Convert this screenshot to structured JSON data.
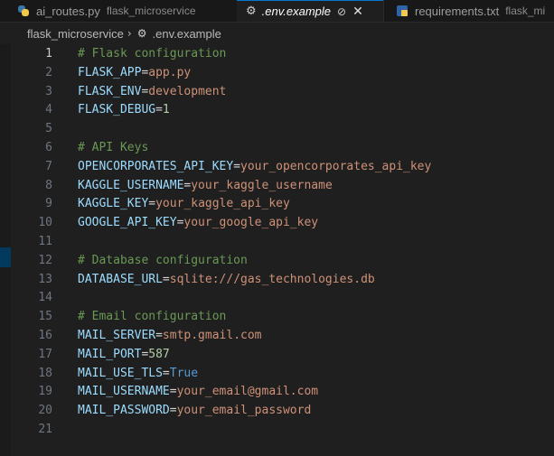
{
  "tabs": [
    {
      "label": "ai_routes.py",
      "description": "flask_microservice",
      "icon": "python-icon"
    },
    {
      "label": ".env.example",
      "icon": "settings-icon",
      "active": true,
      "pinned": true
    },
    {
      "label": "requirements.txt",
      "description": "flask_mi",
      "icon": "text-file-icon"
    }
  ],
  "breadcrumb": {
    "folder": "flask_microservice",
    "file": ".env.example"
  },
  "editor": {
    "lines": [
      {
        "num": "1",
        "comment": "# Flask configuration"
      },
      {
        "num": "2",
        "key": "FLASK_APP",
        "value": "app.py"
      },
      {
        "num": "3",
        "key": "FLASK_ENV",
        "value": "development"
      },
      {
        "num": "4",
        "key": "FLASK_DEBUG",
        "value": "1"
      },
      {
        "num": "5"
      },
      {
        "num": "6",
        "comment": "# API Keys"
      },
      {
        "num": "7",
        "key": "OPENCORPORATES_API_KEY",
        "value": "your_opencorporates_api_key"
      },
      {
        "num": "8",
        "key": "KAGGLE_USERNAME",
        "value": "your_kaggle_username"
      },
      {
        "num": "9",
        "key": "KAGGLE_KEY",
        "value": "your_kaggle_api_key"
      },
      {
        "num": "10",
        "key": "GOOGLE_API_KEY",
        "value": "your_google_api_key"
      },
      {
        "num": "11"
      },
      {
        "num": "12",
        "comment": "# Database configuration"
      },
      {
        "num": "13",
        "key": "DATABASE_URL",
        "value": "sqlite:///gas_technologies.db"
      },
      {
        "num": "14"
      },
      {
        "num": "15",
        "comment": "# Email configuration"
      },
      {
        "num": "16",
        "key": "MAIL_SERVER",
        "value": "smtp.gmail.com"
      },
      {
        "num": "17",
        "key": "MAIL_PORT",
        "value": "587"
      },
      {
        "num": "18",
        "key": "MAIL_USE_TLS",
        "value": "True"
      },
      {
        "num": "19",
        "key": "MAIL_USERNAME",
        "value": "your_email@gmail.com"
      },
      {
        "num": "20",
        "key": "MAIL_PASSWORD",
        "value": "your_email_password"
      },
      {
        "num": "21"
      }
    ]
  },
  "colors": {
    "key": "#9cdcfe",
    "string": "#ce9178",
    "comment": "#6a9955",
    "number": "#b5cea8",
    "boolean": "#569cd6",
    "active_tab_border": "#0078d4"
  }
}
